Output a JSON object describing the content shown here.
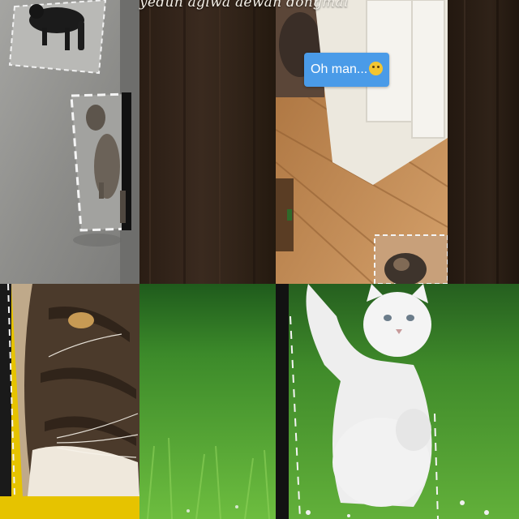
{
  "collage": {
    "caption": "yedun agiwa aewan dongmai",
    "bubble_text": "Oh man...",
    "emoji_name": "grimacing-face-icon",
    "tiles": [
      {
        "position": "top-left",
        "subject": "dogs-on-pavement"
      },
      {
        "position": "top-center",
        "subject": "dark-wood-panel"
      },
      {
        "position": "top-right",
        "subject": "kitten-near-door"
      },
      {
        "position": "top-far-right",
        "subject": "dark-wood-strip"
      },
      {
        "position": "bottom-left",
        "subject": "tabby-cat-closeup"
      },
      {
        "position": "bottom-center",
        "subject": "green-grass"
      },
      {
        "position": "bottom-right",
        "subject": "white-cat-in-grass"
      }
    ],
    "colors": {
      "bubble": "#4a9be8",
      "wood_dark": "#2a1d14",
      "grass": "#4b8f2c",
      "yellow": "#e6c300"
    }
  }
}
